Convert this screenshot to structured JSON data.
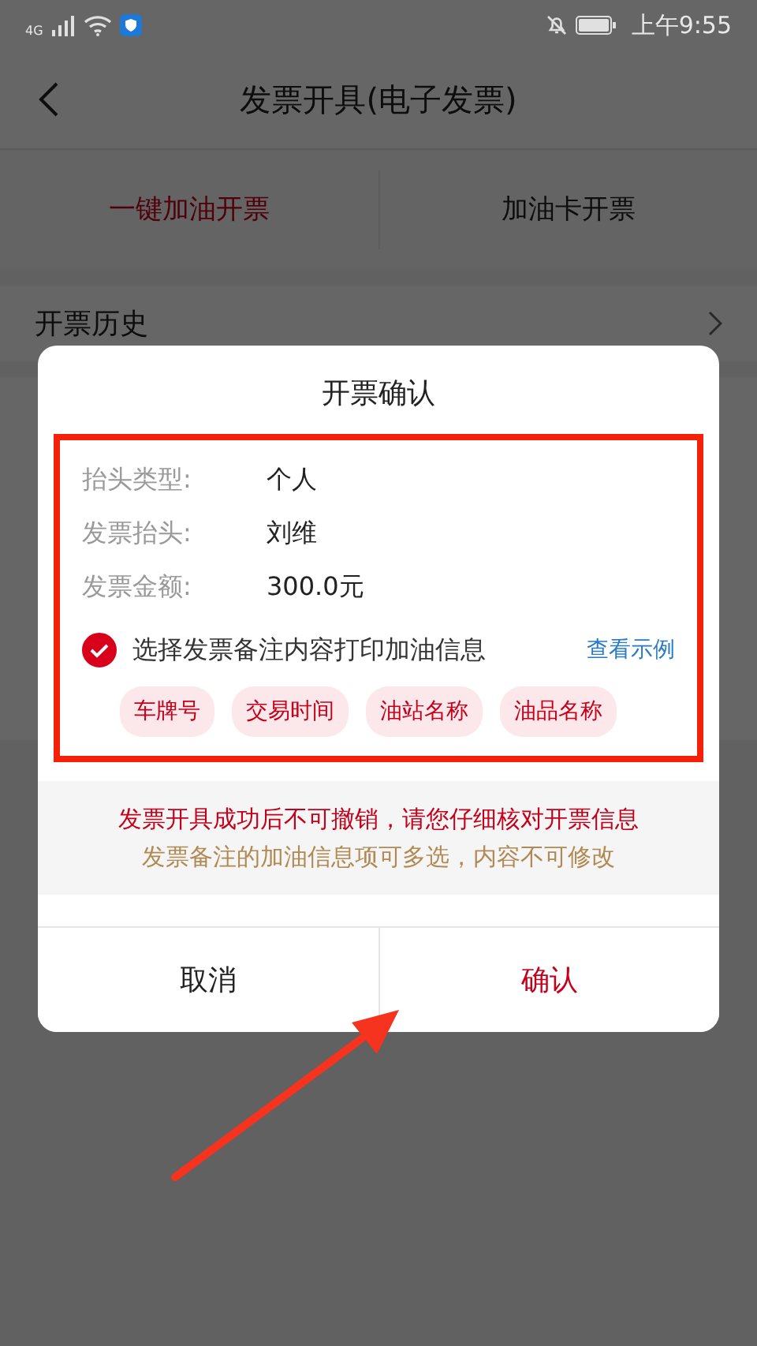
{
  "status_bar": {
    "network": "4G",
    "time": "上午9:55"
  },
  "nav": {
    "title": "发票开具(电子发票)"
  },
  "tabs": [
    {
      "label": "一键加油开票",
      "selected": true
    },
    {
      "label": "加油卡开票",
      "selected": false
    }
  ],
  "history": {
    "label": "开票历史"
  },
  "dialog": {
    "title": "开票确认",
    "fields": [
      {
        "label": "抬头类型:",
        "value": "个人"
      },
      {
        "label": "发票抬头:",
        "value": "刘维"
      },
      {
        "label": "发票金额:",
        "value": "300.0元"
      }
    ],
    "remark": {
      "label": "选择发票备注内容打印加油信息",
      "checked": true,
      "link": "查看示例"
    },
    "tags": [
      "车牌号",
      "交易时间",
      "油站名称",
      "油品名称"
    ],
    "warning": "发票开具成功后不可撤销，请您仔细核对开票信息",
    "note": "发票备注的加油信息项可多选，内容不可修改",
    "buttons": [
      {
        "label": "取消",
        "kind": "cancel"
      },
      {
        "label": "确认",
        "kind": "confirm"
      }
    ]
  }
}
